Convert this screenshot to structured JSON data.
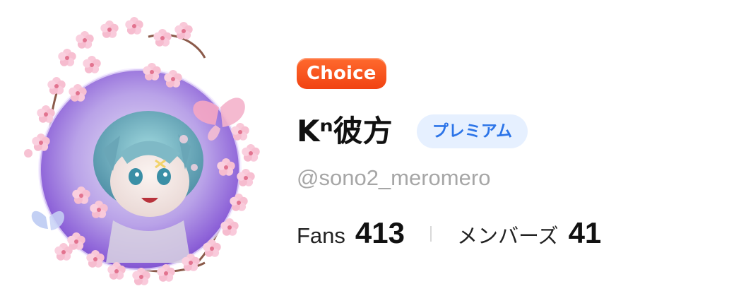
{
  "colors": {
    "choice_badge": "#f14312",
    "premium_bg": "#e6f0ff",
    "premium_text": "#2c74e8",
    "handle_text": "#a6a6a6"
  },
  "profile": {
    "avatar_icon": "avatar-cherry-blossom-frame",
    "choice_badge": "Choice",
    "display_name": "Kⁿ彼方",
    "premium_badge": "プレミアム",
    "handle": "@sono2_meromero"
  },
  "stats": {
    "fans_label": "Fans",
    "fans_value": "413",
    "members_label": "メンバーズ",
    "members_value": "41"
  }
}
